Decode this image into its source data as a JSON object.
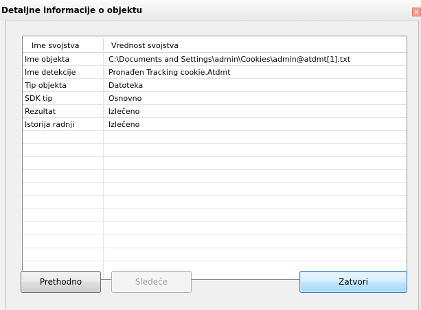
{
  "window": {
    "title": "Detaljne informacije o objektu",
    "close_glyph": "×"
  },
  "table": {
    "columns": [
      "Ime svojstva",
      "Vrednost svojstva"
    ],
    "rows": [
      [
        "Ime objekta",
        "C:\\Documents and Settings\\admin\\Cookies\\admin@atdmt[1].txt"
      ],
      [
        "Ime detekcije",
        "Pronađen Tracking cookie.Atdmt"
      ],
      [
        "Tip objekta",
        "Datoteka"
      ],
      [
        "SDK tip",
        "Osnovno"
      ],
      [
        "Rezultat",
        "Izlečeno"
      ],
      [
        "Istorija radnji",
        "Izlečeno"
      ]
    ],
    "empty_rows": 10
  },
  "buttons": {
    "previous": "Prethodno",
    "next": "Sledeće",
    "close": "Zatvori"
  }
}
